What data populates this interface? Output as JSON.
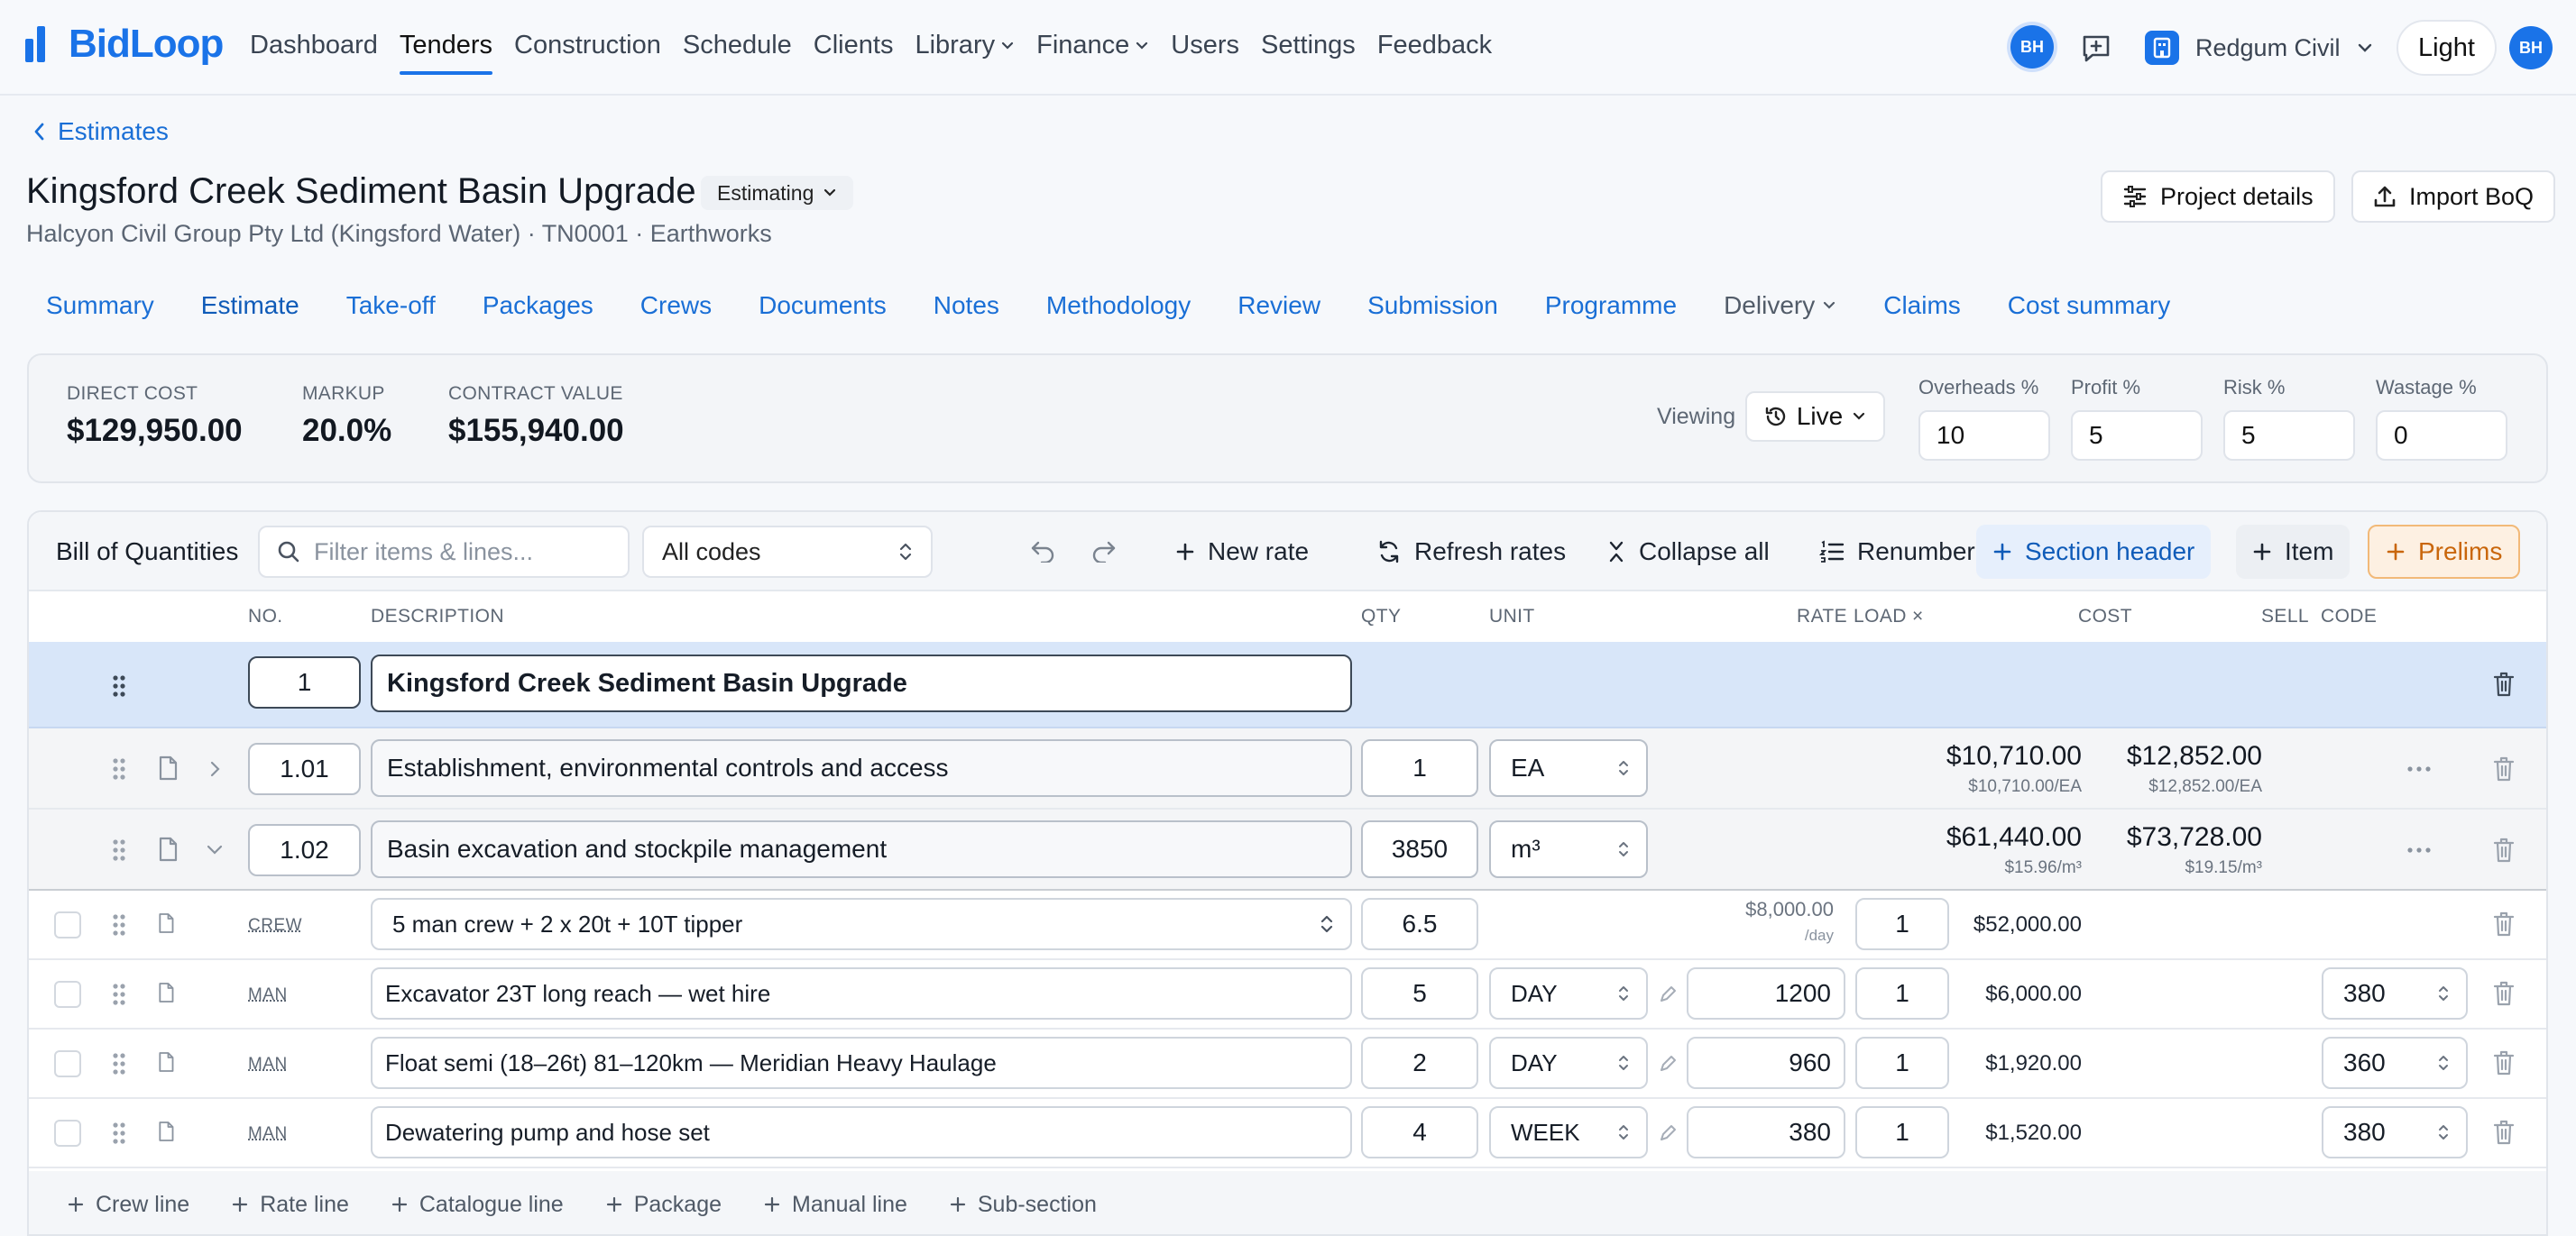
{
  "app": {
    "brand": "BidLoop",
    "nav": [
      {
        "label": "Dashboard",
        "active": false,
        "dropdown": false
      },
      {
        "label": "Tenders",
        "active": true,
        "dropdown": false
      },
      {
        "label": "Construction",
        "active": false,
        "dropdown": false
      },
      {
        "label": "Schedule",
        "active": false,
        "dropdown": false
      },
      {
        "label": "Clients",
        "active": false,
        "dropdown": false
      },
      {
        "label": "Library",
        "active": false,
        "dropdown": true
      },
      {
        "label": "Finance",
        "active": false,
        "dropdown": true
      },
      {
        "label": "Users",
        "active": false,
        "dropdown": false
      },
      {
        "label": "Settings",
        "active": false,
        "dropdown": false
      },
      {
        "label": "Feedback",
        "active": false,
        "dropdown": false
      }
    ],
    "user_initials": "BH",
    "org_name": "Redgum Civil",
    "theme_label": "Light",
    "accent": "#1a73e8"
  },
  "page": {
    "back_label": "Estimates",
    "title": "Kingsford Creek Sediment Basin Upgrade",
    "status": "Estimating",
    "subtitle": "Halcyon Civil Group Pty Ltd (Kingsford Water) · TN0001 · Earthworks",
    "project_details_label": "Project details",
    "import_label": "Import BoQ"
  },
  "tabs": [
    {
      "label": "Summary"
    },
    {
      "label": "Estimate",
      "active": true
    },
    {
      "label": "Take-off"
    },
    {
      "label": "Packages"
    },
    {
      "label": "Crews"
    },
    {
      "label": "Documents"
    },
    {
      "label": "Notes"
    },
    {
      "label": "Methodology"
    },
    {
      "label": "Review"
    },
    {
      "label": "Submission"
    },
    {
      "label": "Programme"
    },
    {
      "label": "Delivery",
      "dropdown": true
    },
    {
      "label": "Claims"
    },
    {
      "label": "Cost summary"
    }
  ],
  "summary": {
    "direct_cost_label": "DIRECT COST",
    "direct_cost": "$129,950.00",
    "markup_label": "MARKUP",
    "markup": "20.0%",
    "contract_label": "CONTRACT VALUE",
    "contract_value": "$155,940.00",
    "viewing_label": "Viewing",
    "viewing_value": "Live",
    "overheads_label": "Overheads %",
    "overheads": "10",
    "profit_label": "Profit %",
    "profit": "5",
    "risk_label": "Risk %",
    "risk": "5",
    "wastage_label": "Wastage %",
    "wastage": "0"
  },
  "boq": {
    "title": "Bill of Quantities",
    "search_placeholder": "Filter items & lines...",
    "codes_filter": "All codes",
    "new_rate": "New rate",
    "refresh_rates": "Refresh rates",
    "collapse_all": "Collapse all",
    "renumber": "Renumber",
    "section_header": "Section header",
    "item": "Item",
    "prelims": "Prelims",
    "columns": {
      "no": "NO.",
      "description": "DESCRIPTION",
      "qty": "QTY",
      "unit": "UNIT",
      "rate": "RATE",
      "load": "LOAD ×",
      "cost": "COST",
      "sell": "SELL",
      "code": "CODE"
    },
    "section": {
      "no": "1",
      "description": "Kingsford Creek Sediment Basin Upgrade"
    },
    "items": [
      {
        "no": "1.01",
        "description": "Establishment, environmental controls and access",
        "qty": "1",
        "unit": "EA",
        "cost": "$10,710.00",
        "cost_sub": "$10,710.00/EA",
        "sell": "$12,852.00",
        "sell_sub": "$12,852.00/EA"
      },
      {
        "no": "1.02",
        "description": "Basin excavation and stockpile management",
        "qty": "3850",
        "unit": "m³",
        "cost": "$61,440.00",
        "cost_sub": "$15.96/m³",
        "sell": "$73,728.00",
        "sell_sub": "$19.15/m³"
      }
    ],
    "crew_line": {
      "type": "CREW",
      "description": "5 man crew + 2 x 20t + 10T tipper",
      "qty": "6.5",
      "rate": "$8,000.00",
      "rate_unit": "/day",
      "load": "1",
      "cost": "$52,000.00"
    },
    "lines": [
      {
        "type": "MAN",
        "description": "Excavator 23T long reach — wet hire",
        "qty": "5",
        "unit": "DAY",
        "rate": "1200",
        "load": "1",
        "cost": "$6,000.00",
        "code": "380"
      },
      {
        "type": "MAN",
        "description": "Float semi (18–26t) 81–120km — Meridian Heavy Haulage",
        "qty": "2",
        "unit": "DAY",
        "rate": "960",
        "load": "1",
        "cost": "$1,920.00",
        "code": "360"
      },
      {
        "type": "MAN",
        "description": "Dewatering pump and hose set",
        "qty": "4",
        "unit": "WEEK",
        "rate": "380",
        "load": "1",
        "cost": "$1,520.00",
        "code": "380"
      }
    ],
    "footer_actions": [
      "Crew line",
      "Rate line",
      "Catalogue line",
      "Package",
      "Manual line",
      "Sub-section"
    ]
  }
}
